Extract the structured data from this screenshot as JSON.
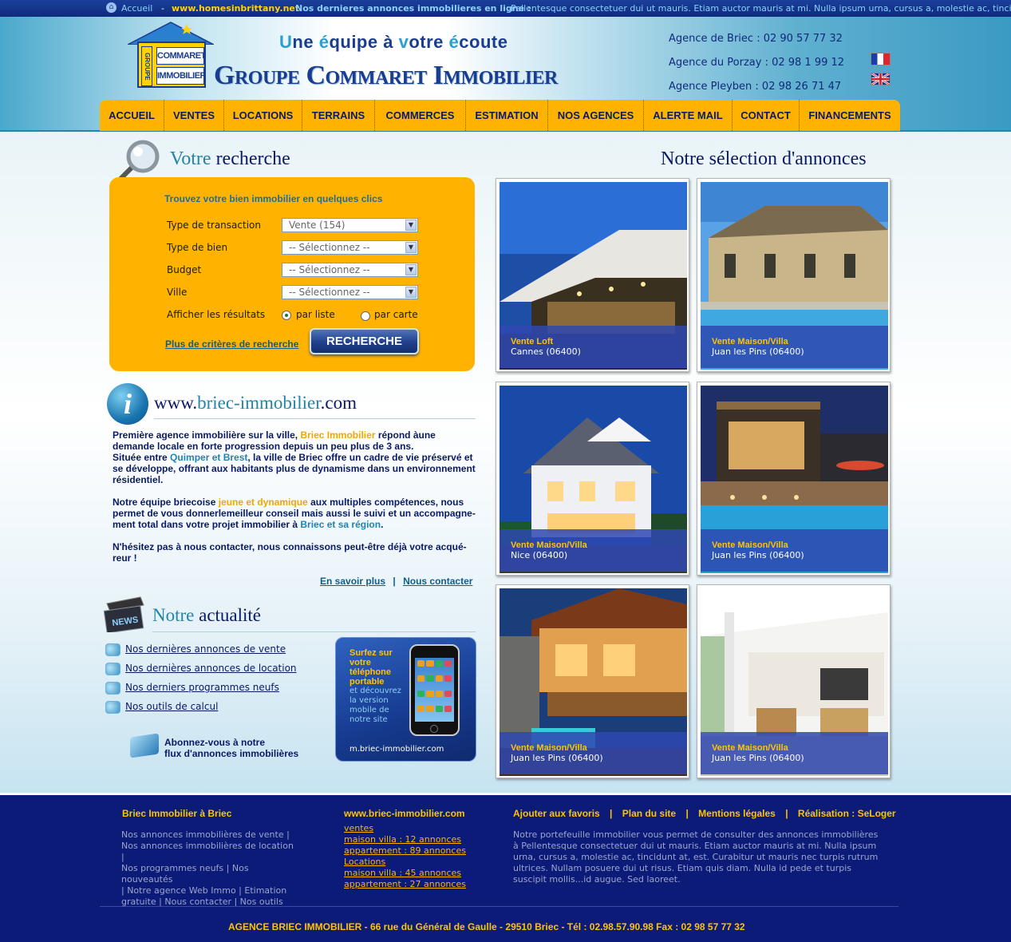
{
  "topbar": {
    "home": "Accueil",
    "sep": "-",
    "site": "www.homesinbrittany.net",
    "latest": "Nos dernieres annonces immobilieres en ligne :",
    "ticker": "Pellentesque consectetuer dui ut mauris. Etiam auctor mauris at mi. Nulla ipsum urna, cursus a, molestie ac, tincidunt"
  },
  "header": {
    "logo_top": "COMMARET",
    "logo_bottom": "IMMOBILIER",
    "logo_side": "GROUPE",
    "tagline": [
      "U",
      "ne ",
      "é",
      "quipe ",
      "à ",
      "v",
      "otre ",
      "é",
      "coute"
    ],
    "brand": "Groupe Commaret Immobilier",
    "agencies": [
      "Agence de Briec : 02 90 57 77 32",
      "Agence du Porzay : 02 98 1 99 12",
      "Agence Pleyben : 02 98 26 71 47"
    ]
  },
  "nav": [
    "ACCUEIL",
    "VENTES",
    "LOCATIONS",
    "TERRAINS",
    "COMMERCES",
    "ESTIMATION",
    "NOS AGENCES",
    "ALERTE MAIL",
    "CONTACT",
    "FINANCEMENTS"
  ],
  "search": {
    "title_a": "Votre",
    "title_b": " recherche",
    "intro": "Trouvez votre bien immobilier en quelques clics",
    "fields": [
      {
        "label": "Type de transaction",
        "value": "Vente (154)"
      },
      {
        "label": "Type de bien",
        "value": "-- Sélectionnez --"
      },
      {
        "label": "Budget",
        "value": "-- Sélectionnez --"
      },
      {
        "label": "Ville",
        "value": "-- Sélectionnez --"
      }
    ],
    "results_label": "Afficher les résultats",
    "radio_list": "par liste",
    "radio_map": "par carte",
    "more": "Plus de critères de recherche",
    "button": "RECHERCHE"
  },
  "info": {
    "title_a": "www.",
    "title_b": "briec-immobilier",
    "title_c": ".com",
    "p1a": "Première agence immobilière sur la ville, ",
    "p1b": "Briec Immobilier",
    "p1c": " répond àune demande locale en forte progression depuis un peu plus de 3 ans.",
    "p2a": "Située entre ",
    "p2b": "Quimper et Brest",
    "p2c": ", la ville de Briec offre un cadre de vie préservé et se développe, offrant aux habitants plus de dynamisme dans un environnement résidentiel.",
    "p3a": "Notre équipe briecoise ",
    "p3b": "jeune et dynamique",
    "p3c": " aux multiples compétences, nous permet de vous donnerlemeilleur conseil mais aussi le suivi et un accompagne-ment total dans votre projet immobilier à ",
    "p3d": "Briec et sa région",
    "p3e": ".",
    "p4": "N'hésitez pas à nous contacter, nous connaissons peut-être déjà votre acqué-reur !",
    "link1": "En savoir plus",
    "link_sep": "|",
    "link2": "Nous contacter"
  },
  "news": {
    "icon_label": "NEWS",
    "title_a": "Notre",
    "title_b": " actualité",
    "items": [
      "Nos dernières annonces de vente",
      "Nos dernières annonces de location",
      "Nos derniers programmes neufs",
      "Nos outils de calcul"
    ],
    "feed_1": "Abonnez-vous à notre",
    "feed_2": "flux d'annonces immobilières",
    "mobile_1": "Surfez sur",
    "mobile_2": "votre",
    "mobile_3": "téléphone",
    "mobile_4": "portable",
    "mobile_sub": [
      "et découvrez",
      "la version",
      "mobile de",
      "notre site"
    ],
    "mobile_url": "m.briec-immobilier.com"
  },
  "selection": {
    "title": "Notre sélection d'annonces",
    "cards": [
      {
        "type": "Vente Loft",
        "place": "Cannes (06400)"
      },
      {
        "type": "Vente Maison/Villa",
        "place": "Juan les Pins (06400)"
      },
      {
        "type": "Vente Maison/Villa",
        "place": "Nice (06400)"
      },
      {
        "type": "Vente Maison/Villa",
        "place": "Juan les Pins (06400)"
      },
      {
        "type": "Vente Maison/Villa",
        "place": "Juan les Pins (06400)"
      },
      {
        "type": "Vente Maison/Villa",
        "place": "Juan les Pins (06400)"
      }
    ]
  },
  "footer": {
    "col1_title": "Briec Immobilier à Briec",
    "col1_lines": [
      "Nos annonces immobilières de vente |",
      "Nos annonces immobilières de location |",
      "Nos programmes neufs | Nos nouveautés",
      "| Notre agence Web Immo | Etimation",
      "gratuite | Nous contacter | Nos outils"
    ],
    "col2_title": "www.briec-immobilier.com",
    "col2_lines": [
      "ventes",
      "maison villa : 12 annonces",
      "appartement : 89 annonces",
      "Locations",
      "maison villa : 45 annonces",
      "appartement : 27 annonces"
    ],
    "col3_links": [
      "Ajouter aux favoris",
      "Plan du site",
      "Mentions légales",
      "Réalisation : SeLoger"
    ],
    "col3_sep": "|",
    "col3_text": "Notre portefeuille immobilier vous permet de consulter des annonces immobilières à Pellentesque consectetuer dui ut mauris. Etiam auctor mauris at mi. Nulla ipsum urna, cursus a, molestie ac, tincidunt at, est. Curabitur ut mauris nec turpis rutrum ultrices. Nullam posuere dui ut risus. Etiam quis diam. Nulla id pede et turpis suscipit mollis...id augue. Sed laoreet.",
    "address": "AGENCE BRIEC IMMOBILIER - 66 rue du Général de Gaulle - 29510 Briec -  Tél : 02.98.57.90.98  Fax : 02 98 57 77 32"
  }
}
